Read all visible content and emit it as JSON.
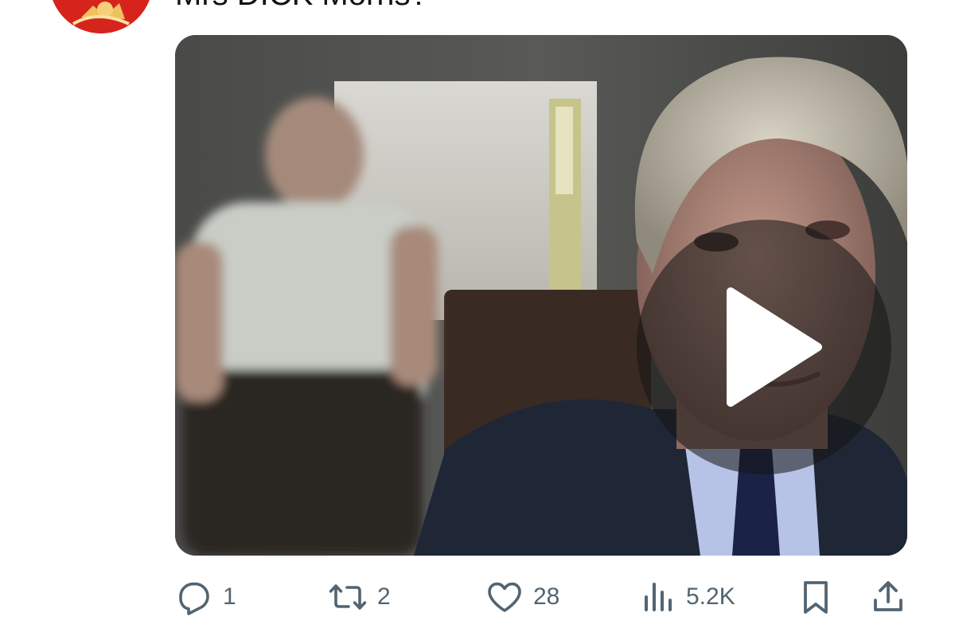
{
  "tweet": {
    "text": "Mrs DICK Morris?"
  },
  "media": {
    "type": "video"
  },
  "actions": {
    "reply_count": "1",
    "retweet_count": "2",
    "like_count": "28",
    "views_count": "5.2K"
  },
  "colors": {
    "icon": "#536471",
    "avatar": "#d6241c"
  }
}
